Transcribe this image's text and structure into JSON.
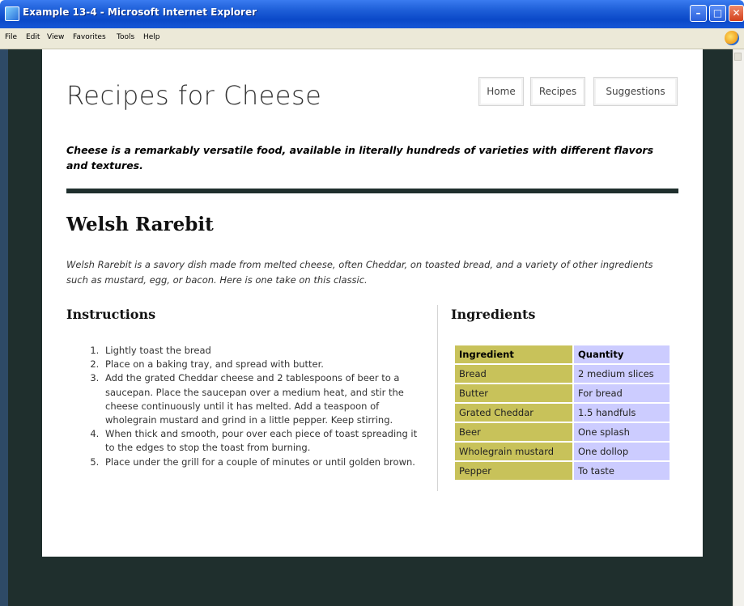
{
  "window": {
    "title": "Example 13-4 - Microsoft Internet Explorer",
    "min_glyph": "–",
    "max_glyph": "□",
    "close_glyph": "✕"
  },
  "menu": {
    "items": [
      "File",
      "Edit",
      "View",
      "Favorites",
      "Tools",
      "Help"
    ]
  },
  "site": {
    "title": "Recipes for Cheese",
    "nav": [
      "Home",
      "Recipes",
      "Suggestions"
    ],
    "tagline": "Cheese is a remarkably versatile food, available in literally hundreds of varieties with different flavors and textures."
  },
  "recipe": {
    "title": "Welsh Rarebit",
    "intro": "Welsh Rarebit is a savory dish made from melted cheese, often Cheddar, on toasted bread, and a variety of other ingredients such as mustard, egg, or bacon. Here is one take on this classic.",
    "instructions_heading": "Instructions",
    "steps": [
      "Lightly toast the bread",
      "Place on a baking tray, and spread with butter.",
      "Add the grated Cheddar cheese and 2 tablespoons of beer to a saucepan. Place the saucepan over a medium heat, and stir the cheese continuously until it has melted. Add a teaspoon of wholegrain mustard and grind in a little pepper. Keep stirring.",
      "When thick and smooth, pour over each piece of toast spreading it to the edges to stop the toast from burning.",
      "Place under the grill for a couple of minutes or until golden brown."
    ],
    "ingredients_heading": "Ingredients",
    "table": {
      "headers": [
        "Ingredient",
        "Quantity"
      ],
      "rows": [
        [
          "Bread",
          "2 medium slices"
        ],
        [
          "Butter",
          "For bread"
        ],
        [
          "Grated Cheddar",
          "1.5 handfuls"
        ],
        [
          "Beer",
          "One splash"
        ],
        [
          "Wholegrain mustard",
          "One dollop"
        ],
        [
          "Pepper",
          "To taste"
        ]
      ]
    }
  },
  "colors": {
    "page_background": "#1f2f2d",
    "ingredient_column": "#c8c25a",
    "quantity_column": "#ccccff",
    "title_bar": "#0a48c8"
  },
  "icons": {
    "window_icon": "ie-page-icon",
    "brand_logo": "windows-ie-logo-icon"
  }
}
